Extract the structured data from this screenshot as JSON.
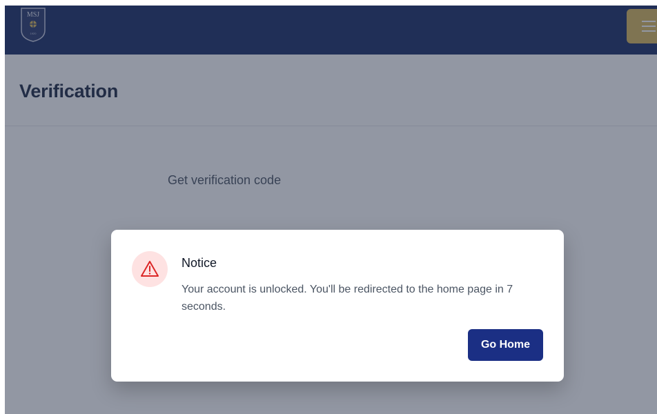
{
  "header": {
    "logo": {
      "text": "MSJ",
      "year": "1920",
      "icon": "school-crest-icon"
    },
    "menu_icon": "hamburger-menu-icon"
  },
  "page": {
    "title": "Verification",
    "verify_link": "Get verification code"
  },
  "modal": {
    "icon": "warning-triangle-icon",
    "title": "Notice",
    "message": "Your account is unlocked. You'll be redirected to the home page in 7 seconds.",
    "button_label": "Go Home"
  },
  "colors": {
    "topbar": "#1b2f66",
    "menu_button": "#d9b85c",
    "primary_button": "#1b2f84",
    "warning_bg": "#fee2e2",
    "warning_icon": "#dc2626"
  }
}
